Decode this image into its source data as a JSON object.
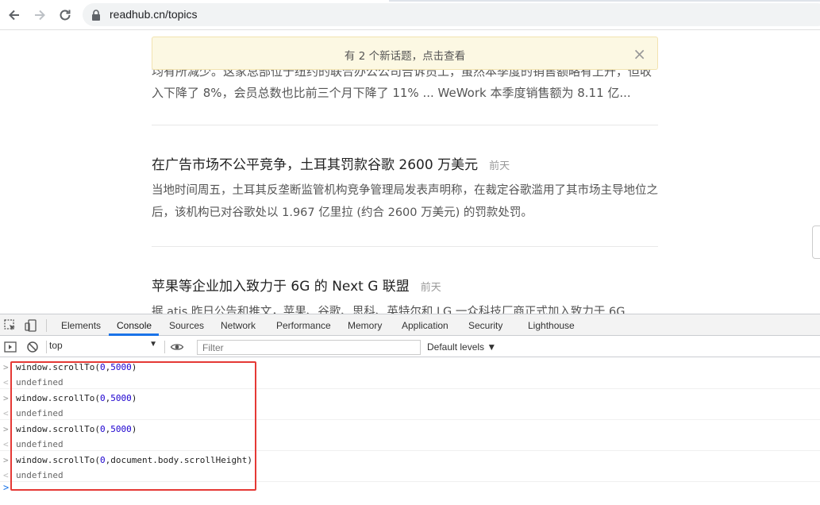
{
  "browser": {
    "url": "readhub.cn/topics"
  },
  "page": {
    "fragment_line_1": "均有所减少。这家总部位于纽约的联合办公公司告诉员工，虽然本季度的销售额略有上升，但收",
    "fragment_line_2": "入下降了 8%，会员总数也比前三个月下降了 11% ... WeWork 本季度销售额为 8.11 亿...",
    "banner": {
      "message": "有 2 个新话题，点击查看",
      "close": "×"
    },
    "topics": [
      {
        "title": "在广告市场不公平竞争，土耳其罚款谷歌 2600 万美元",
        "time": "前天",
        "summary": "当地时间周五，土耳其反垄断监管机构竞争管理局发表声明称，在裁定谷歌滥用了其市场主导地位之后，该机构已对谷歌处以 1.967 亿里拉 (约合 2600 万美元) 的罚款处罚。"
      },
      {
        "title": "苹果等企业加入致力于 6G 的 Next G 联盟",
        "time": "前天",
        "summary": "据 atis 昨日公告和推文，苹果、谷歌、思科、英特尔和 LG 一众科技厂商正式加入致力于 6G"
      }
    ]
  },
  "devtools": {
    "tabs": [
      "Elements",
      "Console",
      "Sources",
      "Network",
      "Performance",
      "Memory",
      "Application",
      "Security",
      "Lighthouse"
    ],
    "active_tab": "Console",
    "context": "top",
    "filter_placeholder": "Filter",
    "levels": "Default levels ▼",
    "entries": [
      {
        "cmd_pre": "window.scrollTo(",
        "cmd_num1": "0",
        "cmd_mid": ",",
        "cmd_num2": "5000",
        "cmd_post": ")",
        "result": "undefined"
      },
      {
        "cmd_pre": "window.scrollTo(",
        "cmd_num1": "0",
        "cmd_mid": ",",
        "cmd_num2": "5000",
        "cmd_post": ")",
        "result": "undefined"
      },
      {
        "cmd_pre": "window.scrollTo(",
        "cmd_num1": "0",
        "cmd_mid": ",",
        "cmd_num2": "5000",
        "cmd_post": ")",
        "result": "undefined"
      },
      {
        "cmd_pre": "window.scrollTo(",
        "cmd_num1": "0",
        "cmd_mid": ",document.body.scrollHeight",
        "cmd_num2": "",
        "cmd_post": ")",
        "result": "undefined"
      }
    ],
    "prompt_symbol": ">",
    "result_symbol": "<"
  },
  "colors": {
    "highlight": "#e53935",
    "active_tab_underline": "#1a73e8",
    "banner_bg": "#fcf8e3"
  }
}
